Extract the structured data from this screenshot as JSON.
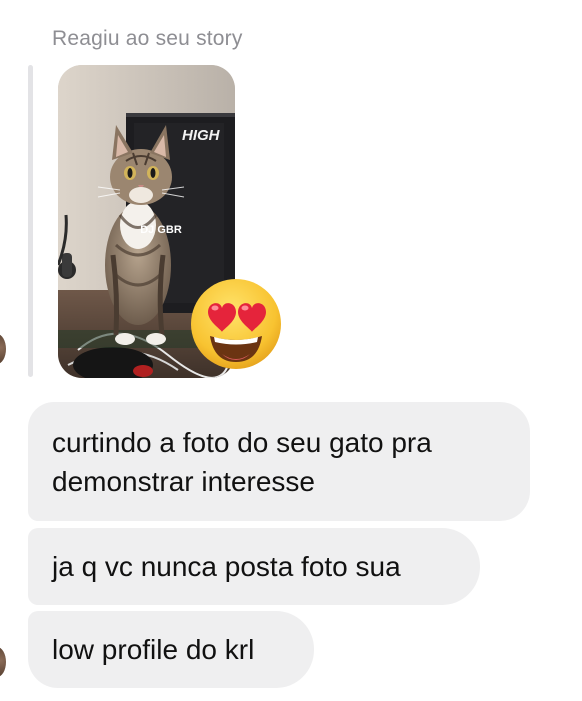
{
  "story_reply": {
    "label": "Reagiu ao seu story",
    "thumbnail": {
      "subject": "cat-photo",
      "overlay_text": "DJ GBR",
      "background_sign": "HIGH"
    },
    "reaction": {
      "emoji": "😍",
      "icon": "heart-eyes-emoji"
    }
  },
  "messages": [
    {
      "text": "curtindo a foto do seu gato pra\ndemonstrar interesse"
    },
    {
      "text": "ja q vc nunca posta foto sua"
    },
    {
      "text": "low profile do krl"
    }
  ],
  "colors": {
    "bubble_bg": "#efeff0",
    "label_text": "#8e8e93",
    "message_text": "#111111",
    "quote_bar": "#e3e3e6"
  }
}
